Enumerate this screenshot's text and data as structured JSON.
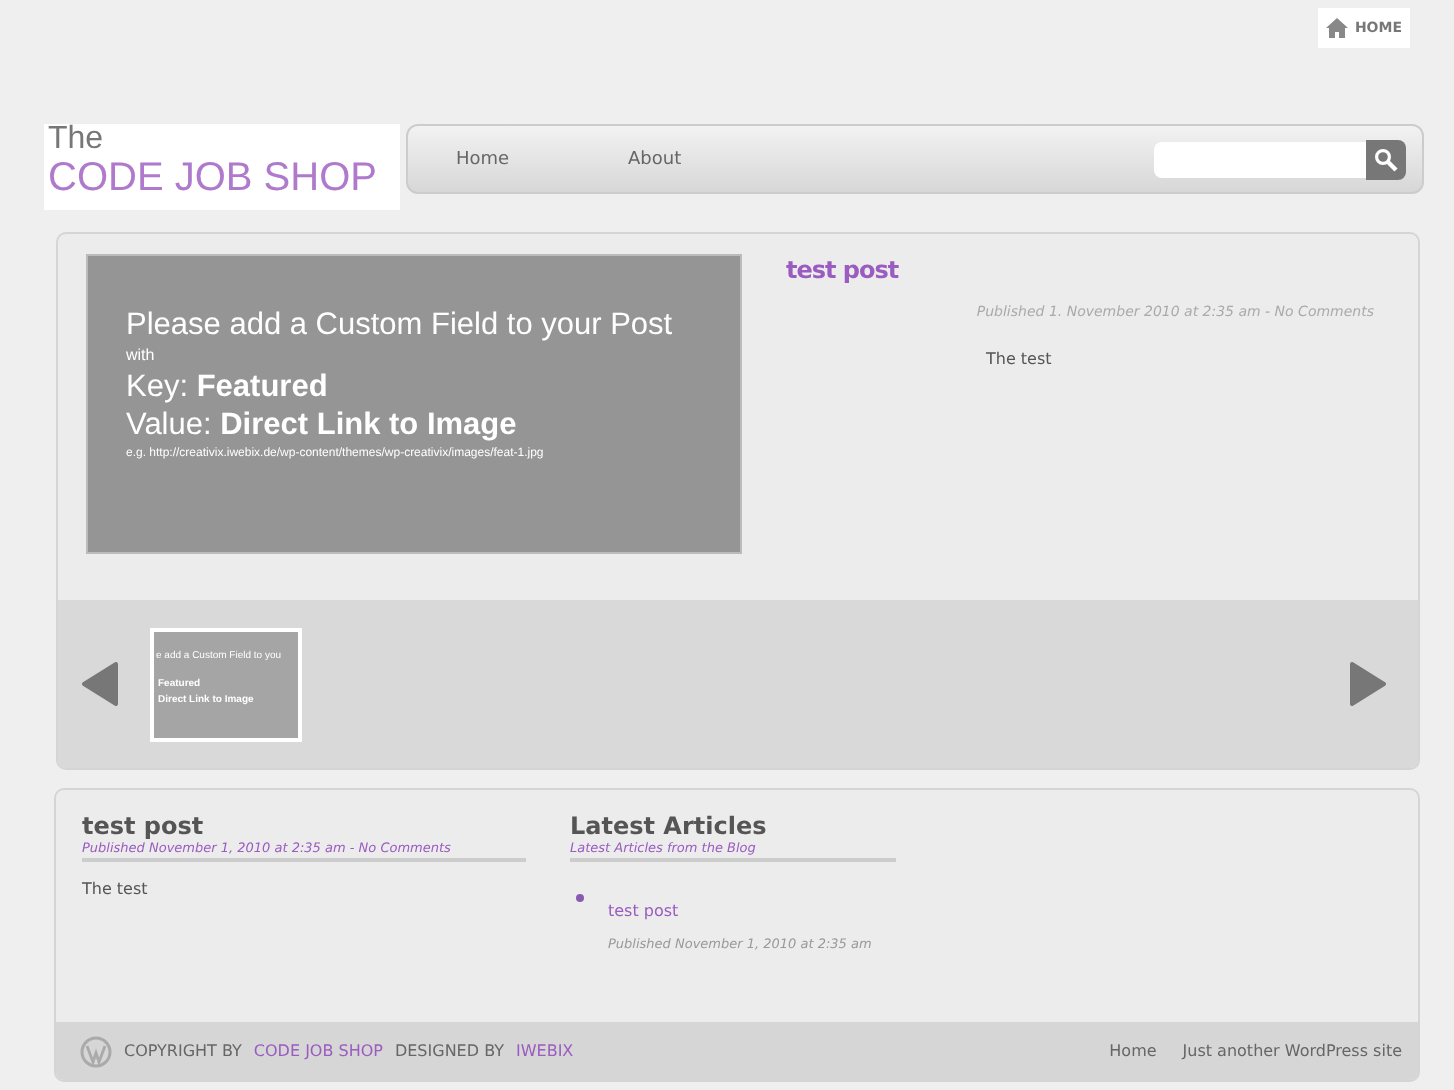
{
  "top_link": {
    "label": "HOME"
  },
  "logo": {
    "line_1": "The",
    "line_2": "CODE JOB SHOP"
  },
  "nav": {
    "items": [
      {
        "label": "Home",
        "selected": false
      },
      {
        "label": "About",
        "selected": false
      }
    ]
  },
  "featured": {
    "image_lines": [
      "Please add a Custom Field to your Post",
      "with",
      "Key: **Featured**",
      "Value: **Direct Link to Image**",
      "e.g. http://creativix.iwebix.de/wp-content/themes/wp-creativix/images/feat-1.jpg"
    ],
    "title": "test post",
    "meta": "Published 1. November 2010 at 2:35 am - No Comments",
    "excerpt": "The test"
  },
  "slider": {
    "thumbnails": [
      {
        "lines": [
          "e add a Custom Field to you",
          "Featured",
          "Direct Link to Image"
        ],
        "selected": true
      }
    ]
  },
  "post": {
    "title": "test post",
    "meta": "Published November 1, 2010 at 2:35 am - No Comments",
    "body": "The test"
  },
  "latest": {
    "title": "Latest Articles",
    "subtitle": "Latest Articles from the Blog",
    "items": [
      {
        "title": "test post",
        "meta": "Published November 1, 2010 at 2:35 am"
      }
    ]
  },
  "footer": {
    "parts": [
      {
        "text": "COPYRIGHT BY",
        "kind": "text"
      },
      {
        "text": "CODE JOB SHOP",
        "kind": "link"
      },
      {
        "text": "DESIGNED BY",
        "kind": "text"
      },
      {
        "text": "IWEBIX",
        "kind": "link"
      }
    ],
    "links": [
      "Home",
      "Just another WordPress site"
    ]
  }
}
